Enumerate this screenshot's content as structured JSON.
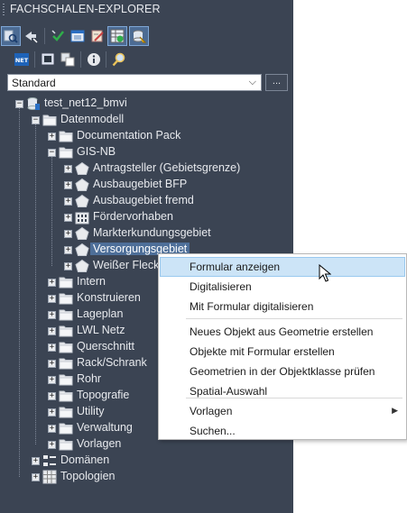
{
  "panel": {
    "title": "FACHSCHALEN-EXPLORER"
  },
  "toolbar": {
    "row1": [
      "explorer-icon",
      "fly-icon",
      "check-icon",
      "layout-icon",
      "edit-icon",
      "table-icon",
      "database-icon"
    ],
    "row2": [
      "net-icon",
      "screen-icon",
      "layers-icon",
      "info-icon",
      "search-icon"
    ],
    "net_label": "NET"
  },
  "combo": {
    "value": "Standard",
    "chevron": "⌵",
    "more": "..."
  },
  "tree": {
    "root": "test_net12_bmvi",
    "datenmodell": "Datenmodell",
    "documentation_pack": "Documentation Pack",
    "gis_nb": "GIS-NB",
    "gis_children": [
      "Antragsteller (Gebietsgrenze)",
      "Ausbaugebiet BFP",
      "Ausbaugebiet fremd",
      "Fördervorhaben",
      "Markterkundungsgebiet",
      "Versorgungsgebiet",
      "Weißer Fleck"
    ],
    "folders": [
      "Intern",
      "Konstruieren",
      "Lageplan",
      "LWL Netz",
      "Querschnitt",
      "Rack/Schrank",
      "Rohr",
      "Topografie",
      "Utility",
      "Verwaltung",
      "Vorlagen"
    ],
    "domaenen": "Domänen",
    "topologien": "Topologien",
    "expand_symbol": "+",
    "collapse_symbol": "−"
  },
  "context_menu": {
    "items": [
      "Formular anzeigen",
      "Digitalisieren",
      "Mit Formular digitalisieren",
      "Neues Objekt aus Geometrie erstellen",
      "Objekte mit Formular erstellen",
      "Geometrien in der Objektklasse prüfen",
      "Spatial-Auswahl",
      "Vorlagen",
      "Suchen..."
    ],
    "submenu_arrow": "▶"
  },
  "colors": {
    "panel_bg": "#3b4453",
    "selection": "#4e6f99",
    "menu_hover": "#cce4f7",
    "folder": "#e9ebee"
  }
}
